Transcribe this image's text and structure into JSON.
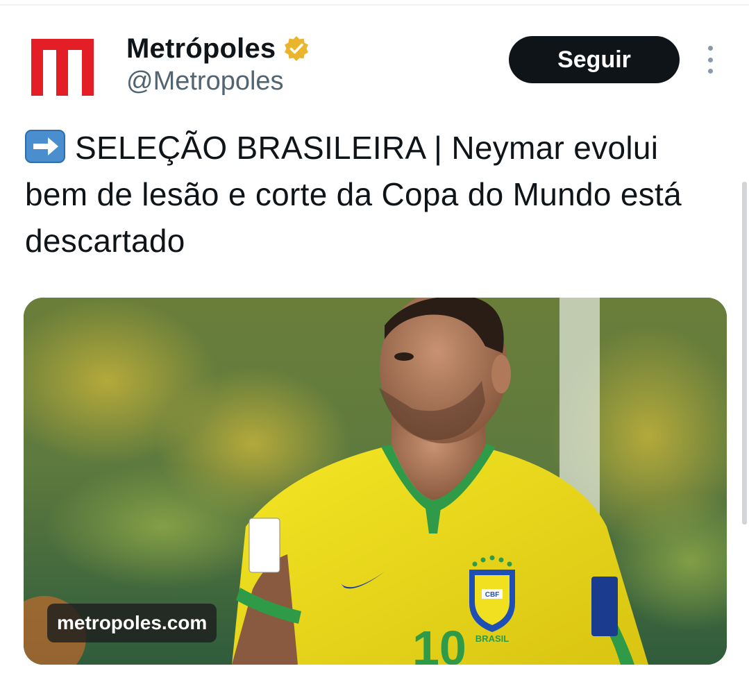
{
  "account": {
    "display_name": "Metrópoles",
    "handle": "@Metropoles",
    "verified": true,
    "avatar_icon": "metropoles-m-logo-icon",
    "avatar_color": "#e41e26",
    "verified_color": "#e8b52c"
  },
  "actions": {
    "follow_label": "Seguir",
    "more_icon": "vertical-ellipsis-icon"
  },
  "tweet": {
    "emoji_icon": "right-arrow-emoji-icon",
    "text": "SELEÇÃO BRASILEIRA | Neymar evolui bem de lesão e corte da Copa do Mundo está descartado"
  },
  "media": {
    "watermark": "metropoles.com",
    "jersey_number": "10",
    "crest_text": "CBF",
    "crest_subtext": "BRASIL",
    "colors": {
      "jersey": "#f2e21a",
      "collar": "#2f9a47",
      "background": "#4f6b3a"
    }
  }
}
